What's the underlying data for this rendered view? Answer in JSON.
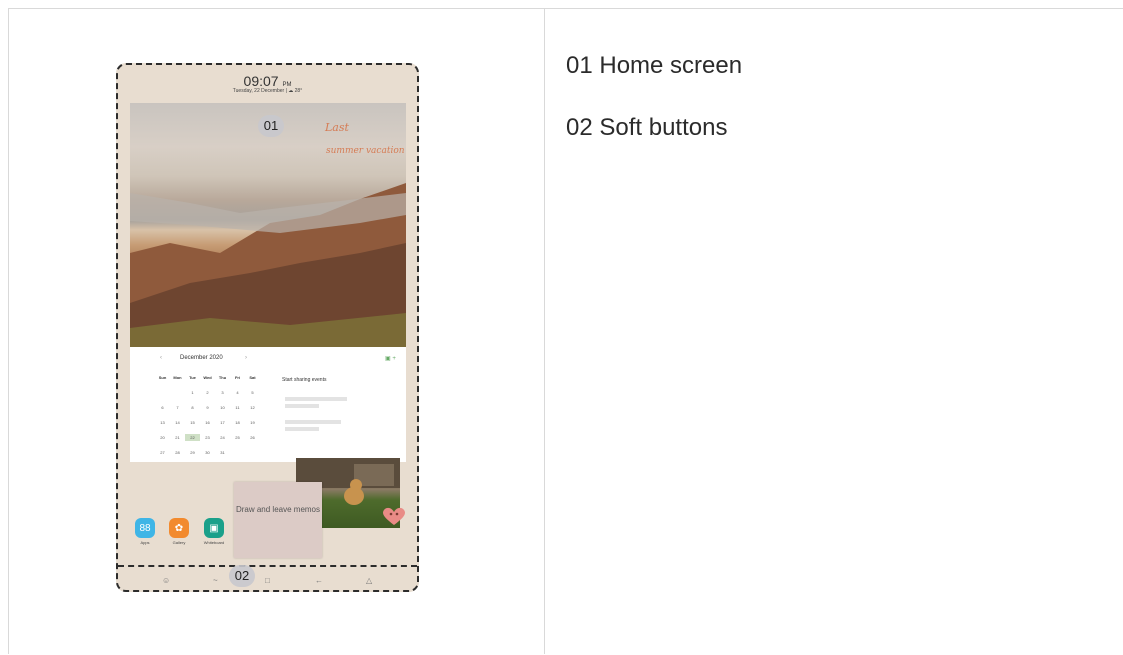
{
  "legend": {
    "item1": "01 Home screen",
    "item2": "02 Soft buttons"
  },
  "device": {
    "clock": "09:07",
    "clock_ampm": "PM",
    "date": "Tuesday, 22 December  |  ☁ 28°",
    "badges": {
      "home": "01",
      "softkeys": "02"
    },
    "wallpaper_text": {
      "line1": "Last",
      "line2": "summer vacation"
    },
    "calendar": {
      "month": "December 2020",
      "side_title": "Start sharing events",
      "weekdays": [
        "Sun",
        "Mon",
        "Tue",
        "Wed",
        "Thu",
        "Fri",
        "Sat"
      ],
      "weeks": [
        [
          "",
          "",
          "1",
          "2",
          "3",
          "4",
          "5"
        ],
        [
          "6",
          "7",
          "8",
          "9",
          "10",
          "11",
          "12"
        ],
        [
          "13",
          "14",
          "15",
          "16",
          "17",
          "18",
          "19"
        ],
        [
          "20",
          "21",
          "22",
          "23",
          "24",
          "25",
          "26"
        ],
        [
          "27",
          "28",
          "29",
          "30",
          "31",
          "",
          ""
        ]
      ],
      "today": "22"
    },
    "memo_text": "Draw and leave memos",
    "apps": [
      {
        "label": "Apps",
        "color": "#3fb5e6",
        "icon": "apps-grid-icon",
        "glyph": "88"
      },
      {
        "label": "Gallery",
        "color": "#f28a2e",
        "icon": "gallery-flower-icon",
        "glyph": "✿"
      },
      {
        "label": "Whiteboard",
        "color": "#1aa08a",
        "icon": "whiteboard-icon",
        "glyph": "▣"
      }
    ],
    "softkeys": [
      "☺",
      "~",
      "□",
      "←",
      "△"
    ]
  }
}
